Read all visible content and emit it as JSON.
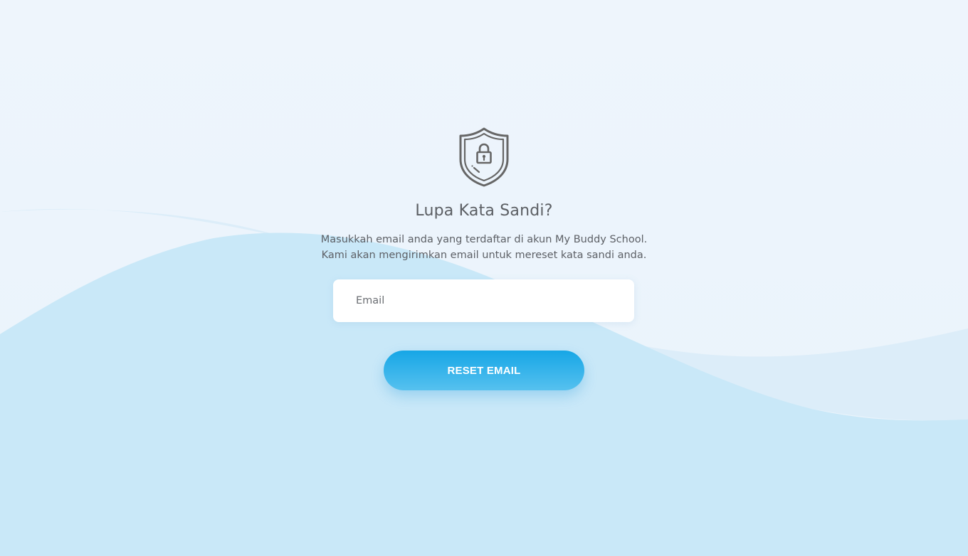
{
  "page": {
    "title": "Lupa Kata Sandi?",
    "description_line1": "Masukkah email anda yang terdaftar di akun My Buddy School.",
    "description_line2": "Kami akan mengirimkan email untuk mereset kata sandi anda."
  },
  "form": {
    "email_placeholder": "Email",
    "email_value": "",
    "submit_label": "RESET EMAIL"
  },
  "icons": {
    "header_icon": "shield-lock-icon"
  },
  "colors": {
    "background": "#eef5fc",
    "wave_light": "#dcedf9",
    "wave_main": "#c9e8f8",
    "button_top": "#16a6e6",
    "button_bottom": "#56c1ef",
    "text": "#5b5e63",
    "icon_stroke": "#666666"
  }
}
